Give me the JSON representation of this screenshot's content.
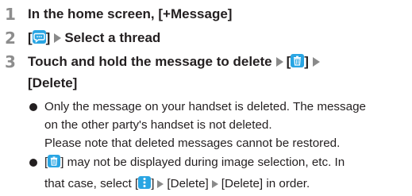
{
  "steps": [
    {
      "number": "1",
      "text": "In the home screen, [+Message]"
    },
    {
      "number": "2",
      "open_bracket": "[",
      "close_bracket": "]",
      "text": "Select a thread"
    },
    {
      "number": "3",
      "text_line1": "Touch and hold the message to delete",
      "open_bracket": "[",
      "close_bracket": "]",
      "text_line2": "[Delete]"
    }
  ],
  "notes": [
    {
      "lines": [
        "Only the message on your handset is deleted. The message",
        "on the other party's handset is not deleted.",
        "Please note that deleted messages cannot be restored."
      ]
    },
    {
      "line1_open": "[",
      "line1_rest": "] may not be displayed during image selection, etc. In",
      "line2_start": "that case, select [",
      "line2_mid": "]",
      "line2_delete1": "[Delete]",
      "line2_delete2": "[Delete]",
      "line2_end": " in order."
    }
  ],
  "icons": {
    "message_icon": "speech-bubble-icon",
    "delete_icon": "trash-icon",
    "menu_icon": "more-vertical-icon",
    "step_arrow": "triangle-right-icon"
  },
  "colors": {
    "icon_blue": "#29a5e3",
    "step_number_gray": "#8d8d8d",
    "arrow_gray": "#8a8a8a",
    "text": "#231f20"
  }
}
